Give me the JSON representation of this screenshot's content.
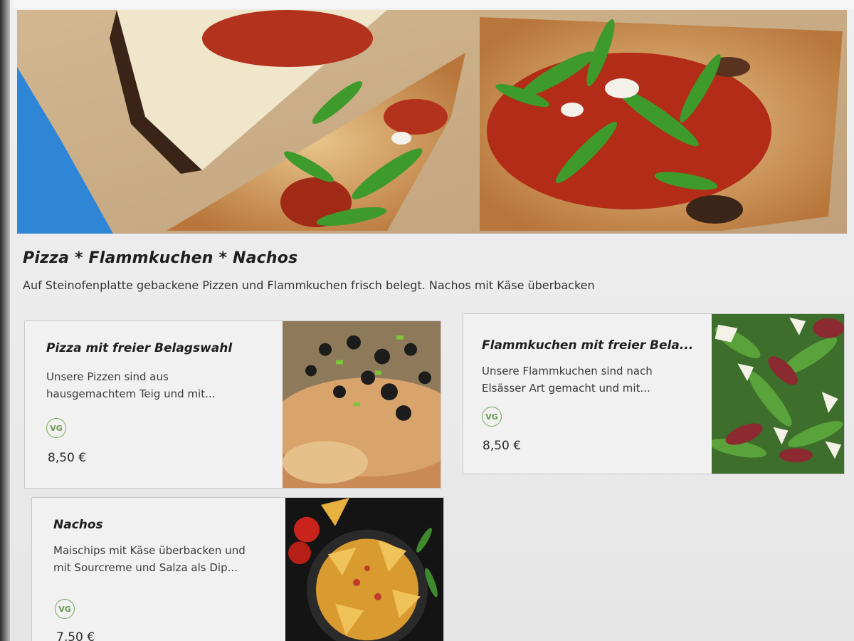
{
  "category": {
    "title": "Pizza * Flammkuchen * Nachos",
    "description": "Auf Steinofenplatte gebackene Pizzen und Flammkuchen frisch belegt. Nachos mit Käse überbacken"
  },
  "products": [
    {
      "title": "Pizza mit freier Belagswahl",
      "description": "Unsere Pizzen sind aus hausgemachtem Teig und mit...",
      "badge": "VG",
      "price": "8,50 €",
      "image_icon": "pizza-olives-photo"
    },
    {
      "title": "Flammkuchen mit freier Bela...",
      "description": "Unsere Flammkuchen sind nach Elsässer Art gemacht und mit...",
      "badge": "VG",
      "price": "8,50 €",
      "image_icon": "flammkuchen-arugula-photo"
    },
    {
      "title": "Nachos",
      "description": "Maischips mit Käse überbacken und mit Sourcreme und Salza als Dip...",
      "badge": "VG",
      "price": "7,50 €",
      "image_icon": "nachos-photo"
    }
  ],
  "colors": {
    "badge_green": "#6b9a4d",
    "card_border": "#c9c9c9",
    "page_bg": "#ececec"
  }
}
